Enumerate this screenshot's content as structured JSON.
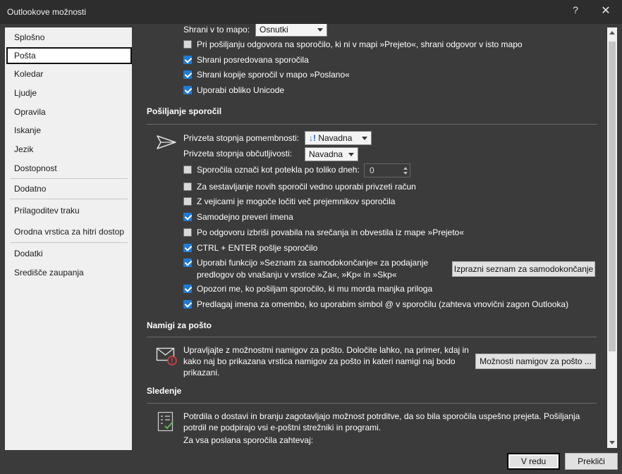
{
  "window": {
    "title": "Outlookove možnosti",
    "help": "?",
    "close": "✕"
  },
  "nav": [
    "Splošno",
    "Pošta",
    "Koledar",
    "Ljudje",
    "Opravila",
    "Iskanje",
    "Jezik",
    "Dostopnost",
    "Dodatno",
    "Prilagoditev traku",
    "Orodna vrstica za hitri dostop",
    "Dodatki",
    "Središče zaupanja"
  ],
  "save": {
    "save_in_label": "Shrani v to mapo:",
    "save_in_value": "Osnutki",
    "options": [
      {
        "label": "Pri pošiljanju odgovora na sporočilo, ki ni v mapi »Prejeto«, shrani odgovor v isto mapo",
        "checked": false
      },
      {
        "label": "Shrani posredovana sporočila",
        "checked": true
      },
      {
        "label": "Shrani kopije sporočil v mapo »Poslano«",
        "checked": true
      },
      {
        "label": "Uporabi obliko Unicode",
        "checked": true
      }
    ]
  },
  "sending": {
    "header": "Pošiljanje sporočil",
    "importance_label": "Privzeta stopnja pomembnosti:",
    "importance_value": "Navadna",
    "importance_icon": "↓!",
    "sensitivity_label": "Privzeta stopnja občutljivosti:",
    "sensitivity_value": "Navadna",
    "expire_label": "Sporočila označi kot potekla po toliko dneh:",
    "expire_value": "0",
    "options": [
      {
        "label": "Za sestavljanje novih sporočil vedno uporabi privzeti račun",
        "checked": false
      },
      {
        "label": "Z vejicami je mogoče ločiti več prejemnikov sporočila",
        "checked": false
      },
      {
        "label": "Samodejno preveri imena",
        "checked": true
      },
      {
        "label": "Po odgovoru izbriši povabila na srečanja in obvestila iz mape »Prejeto«",
        "checked": false
      },
      {
        "label": "CTRL + ENTER pošlje sporočilo",
        "checked": true
      }
    ],
    "autocomplete_line1": "Uporabi funkcijo »Seznam za samodokončanje« za podajanje",
    "autocomplete_line2": "predlogov ob vnašanju v vrstice »Za«, »Kp« in »Skp«",
    "empty_autocomplete_button": "Izprazni seznam za samodokončanje",
    "warn_attachment": "Opozori me, ko pošiljam sporočilo, ki mu morda manjka priloga",
    "suggest_names": "Predlagaj imena za omembo, ko uporabim simbol @ v sporočilu (zahteva vnovični zagon Outlooka)"
  },
  "tips": {
    "header": "Namigi za pošto",
    "text_line1": "Upravljajte z možnostmi namigov za pošto. Določite lahko, na primer, kdaj in",
    "text_line2": "kako naj bo prikazana vrstica namigov za pošto in kateri namigi naj bodo",
    "text_line3": "prikazani.",
    "button": "Možnosti namigov za pošto ..."
  },
  "tracking": {
    "header": "Sledenje",
    "text_line1": "Potrdila o dostavi in branju zagotavljajo možnost potrditve, da so bila sporočila uspešno prejeta. Pošiljanja",
    "text_line2": "potrdil ne podpirajo vsi e-poštni strežniki in programi.",
    "request_label": "Za vsa poslana sporočila zahtevaj:"
  },
  "footer": {
    "ok": "V redu",
    "cancel": "Prekliči"
  },
  "colors": {
    "accent": "#1f7ad6",
    "background": "#3b3b3b",
    "nav": "#f0f0f0"
  }
}
